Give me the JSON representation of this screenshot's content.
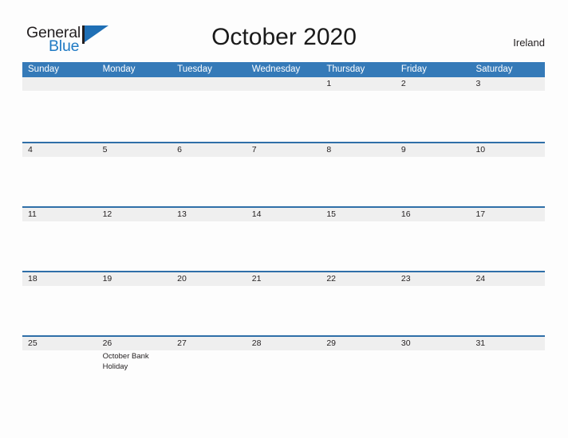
{
  "branding": {
    "logo_primary": "General",
    "logo_secondary": "Blue",
    "logo_flag_icon": "blue-flag-triangle-icon",
    "accent_blue": "#1f7ac4",
    "header_blue": "#357ab8",
    "border_blue": "#2f6fa8",
    "band_gray": "#efefef"
  },
  "header": {
    "title": "October 2020",
    "country": "Ireland"
  },
  "calendar": {
    "month": "October",
    "year": "2020",
    "day_headers": [
      "Sunday",
      "Monday",
      "Tuesday",
      "Wednesday",
      "Thursday",
      "Friday",
      "Saturday"
    ],
    "weeks": [
      {
        "has_top_border": false,
        "days": [
          {
            "date": "",
            "event": ""
          },
          {
            "date": "",
            "event": ""
          },
          {
            "date": "",
            "event": ""
          },
          {
            "date": "",
            "event": ""
          },
          {
            "date": "1",
            "event": ""
          },
          {
            "date": "2",
            "event": ""
          },
          {
            "date": "3",
            "event": ""
          }
        ]
      },
      {
        "has_top_border": true,
        "days": [
          {
            "date": "4",
            "event": ""
          },
          {
            "date": "5",
            "event": ""
          },
          {
            "date": "6",
            "event": ""
          },
          {
            "date": "7",
            "event": ""
          },
          {
            "date": "8",
            "event": ""
          },
          {
            "date": "9",
            "event": ""
          },
          {
            "date": "10",
            "event": ""
          }
        ]
      },
      {
        "has_top_border": true,
        "days": [
          {
            "date": "11",
            "event": ""
          },
          {
            "date": "12",
            "event": ""
          },
          {
            "date": "13",
            "event": ""
          },
          {
            "date": "14",
            "event": ""
          },
          {
            "date": "15",
            "event": ""
          },
          {
            "date": "16",
            "event": ""
          },
          {
            "date": "17",
            "event": ""
          }
        ]
      },
      {
        "has_top_border": true,
        "days": [
          {
            "date": "18",
            "event": ""
          },
          {
            "date": "19",
            "event": ""
          },
          {
            "date": "20",
            "event": ""
          },
          {
            "date": "21",
            "event": ""
          },
          {
            "date": "22",
            "event": ""
          },
          {
            "date": "23",
            "event": ""
          },
          {
            "date": "24",
            "event": ""
          }
        ]
      },
      {
        "has_top_border": true,
        "days": [
          {
            "date": "25",
            "event": ""
          },
          {
            "date": "26",
            "event": "October Bank Holiday"
          },
          {
            "date": "27",
            "event": ""
          },
          {
            "date": "28",
            "event": ""
          },
          {
            "date": "29",
            "event": ""
          },
          {
            "date": "30",
            "event": ""
          },
          {
            "date": "31",
            "event": ""
          }
        ]
      }
    ]
  }
}
